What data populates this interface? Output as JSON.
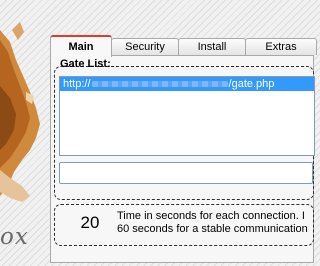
{
  "brand": {
    "text": "ox"
  },
  "tabs": [
    {
      "label": "Main",
      "active": true
    },
    {
      "label": "Security",
      "active": false
    },
    {
      "label": "Install",
      "active": false
    },
    {
      "label": "Extras",
      "active": false
    }
  ],
  "gate": {
    "label": "Gate List:",
    "items": [
      {
        "prefix": "http://",
        "suffix": "/gate.php",
        "selected": true
      }
    ],
    "input_value": ""
  },
  "timeout": {
    "value": "20",
    "line1": "Time in seconds for each connection. I",
    "line2": "60 seconds for a stable communication"
  },
  "colors": {
    "active_tab_accent": "#e23b2e",
    "selection": "#3399ff",
    "input_border": "#7f9db9"
  }
}
